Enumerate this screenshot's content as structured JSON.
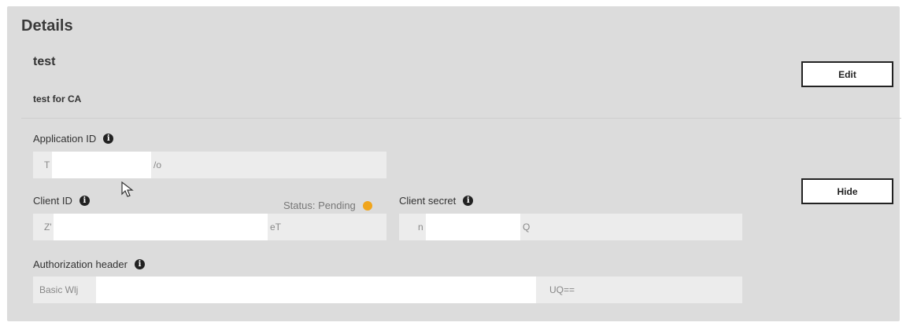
{
  "panel": {
    "title": "Details"
  },
  "app": {
    "name": "test",
    "description": "test for CA",
    "edit_label": "Edit",
    "hide_label": "Hide"
  },
  "fields": {
    "application_id": {
      "label": "Application ID",
      "prefix": "T",
      "suffix": "/o"
    },
    "client_id": {
      "label": "Client ID",
      "prefix": "Z'",
      "suffix": "eT"
    },
    "status": {
      "text": "Status: Pending",
      "color": "#f0a51c"
    },
    "client_secret": {
      "label": "Client secret",
      "prefix": "n",
      "suffix": "Q"
    },
    "authorization_header": {
      "label": "Authorization header",
      "prefix": "Basic Wlj",
      "suffix": "UQ=="
    }
  },
  "icons": {
    "info": "info-icon",
    "cursor": "mouse-cursor-icon"
  }
}
